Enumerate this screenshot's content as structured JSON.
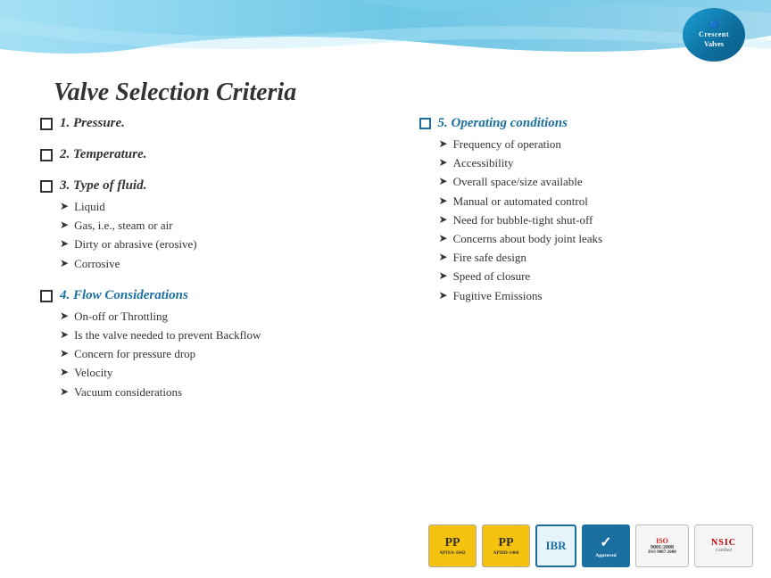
{
  "header": {
    "title": "Valve Selection Criteria",
    "logo": {
      "line1": "Crescent",
      "line2": "Valves"
    }
  },
  "left_column": {
    "items": [
      {
        "id": "pressure",
        "label": "1. Pressure.",
        "sub_items": []
      },
      {
        "id": "temperature",
        "label": "2. Temperature.",
        "sub_items": []
      },
      {
        "id": "fluid",
        "label": "3. Type of fluid.",
        "sub_items": [
          "Liquid",
          "Gas, i.e., steam or air",
          "Dirty or abrasive (erosive)",
          "Corrosive"
        ]
      },
      {
        "id": "flow",
        "label": "4. Flow Considerations",
        "sub_items": [
          "On-off or Throttling",
          "Is the valve needed to prevent Backflow",
          "Concern for pressure drop",
          "Velocity",
          "Vacuum considerations"
        ]
      }
    ]
  },
  "right_column": {
    "section_title": "5. Operating conditions",
    "sub_items": [
      "Frequency of operation",
      "Accessibility",
      "Overall space/size available",
      "Manual or automated control",
      "Need for bubble-tight shut-off",
      "Concerns about body joint leaks",
      "Fire safe design",
      "Speed of closure",
      "Fugitive Emissions"
    ]
  },
  "footer": {
    "badges": [
      {
        "label": "APISA-1642",
        "type": "yellow"
      },
      {
        "label": "API6D-1466",
        "type": "yellow"
      },
      {
        "label": "IBR",
        "type": "blue-outline"
      },
      {
        "label": "✓",
        "type": "blue-solid"
      },
      {
        "label": "ISO 9001:2008",
        "type": "gray"
      },
      {
        "label": "NSIC",
        "type": "gray-red"
      }
    ]
  }
}
